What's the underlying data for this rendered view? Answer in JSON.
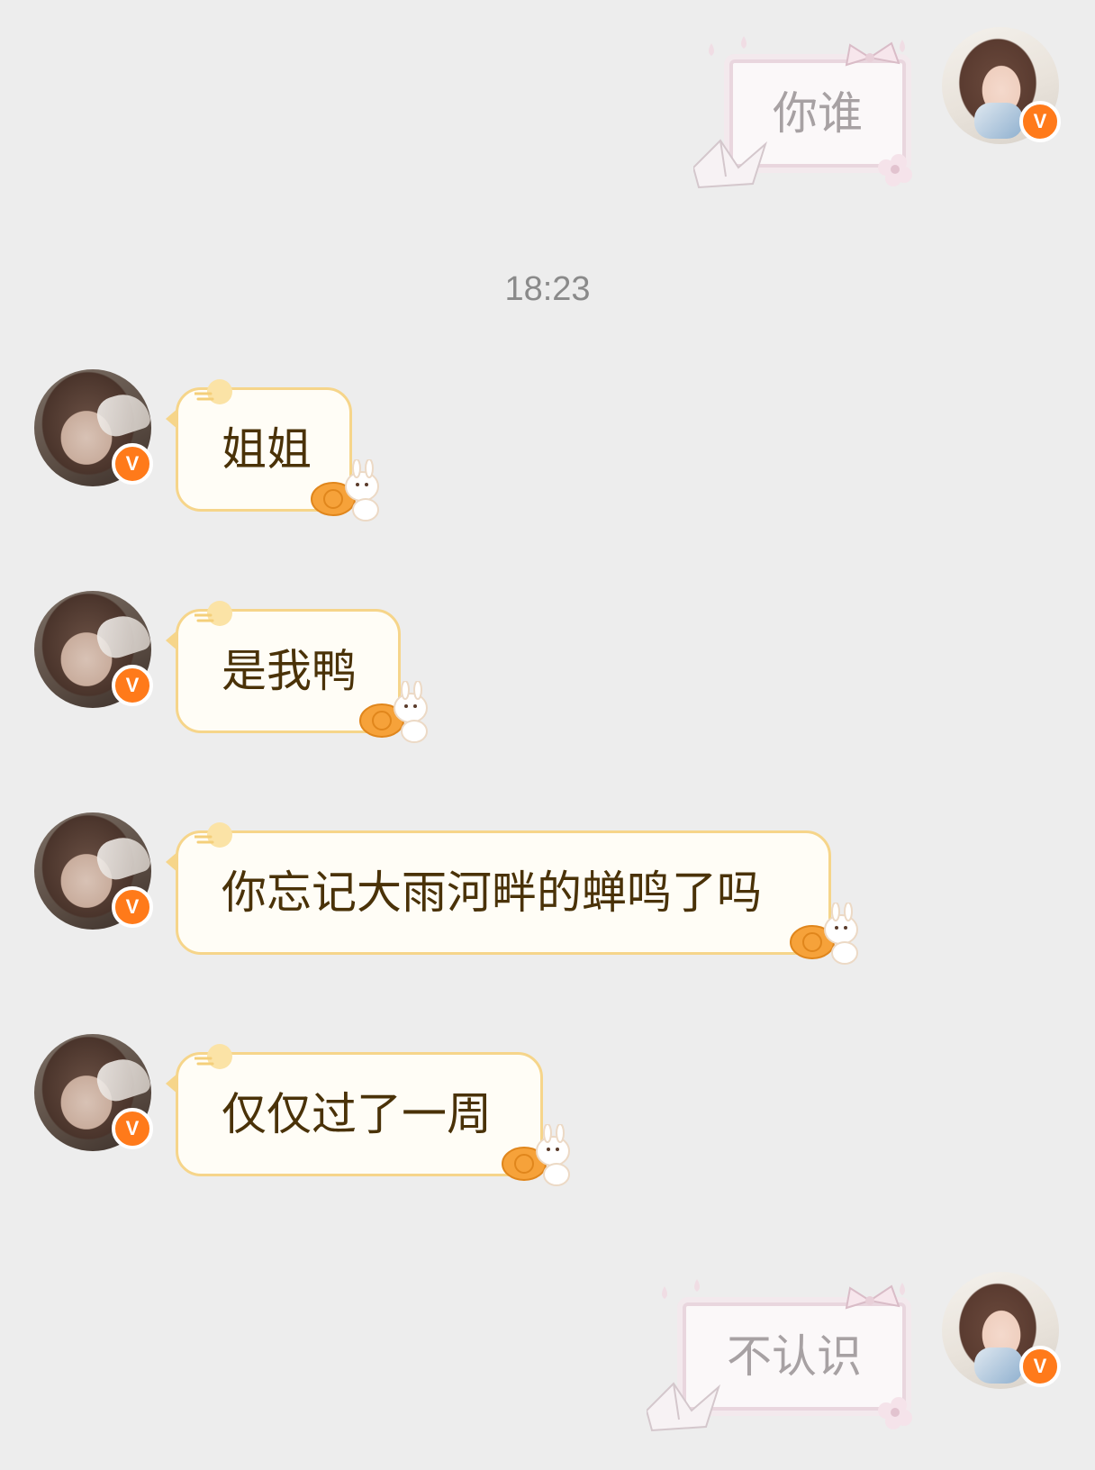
{
  "conversation": {
    "timestamp": "18:23",
    "messages": [
      {
        "sender": "me",
        "text": "你谁"
      },
      {
        "sender": "her",
        "text": "姐姐"
      },
      {
        "sender": "her",
        "text": "是我鸭"
      },
      {
        "sender": "her",
        "text": "你忘记大雨河畔的蝉鸣了吗"
      },
      {
        "sender": "her",
        "text": "仅仅过了一周"
      },
      {
        "sender": "me",
        "text": "不认识"
      }
    ],
    "verified_badge": "V"
  },
  "colors": {
    "background": "#ededed",
    "badge": "#ff7a1a",
    "received_border": "#f6d58a",
    "received_text": "#4a3208",
    "sent_border": "#e9d6de",
    "sent_text": "#a7a1a3"
  },
  "icons": {
    "badge": "verified-v-badge-icon",
    "received_decor": [
      "moon-icon",
      "mooncake-rabbit-icon"
    ],
    "sent_decor": [
      "bow-icon",
      "flower-icon",
      "paper-crane-icon",
      "water-drop-icon"
    ]
  }
}
